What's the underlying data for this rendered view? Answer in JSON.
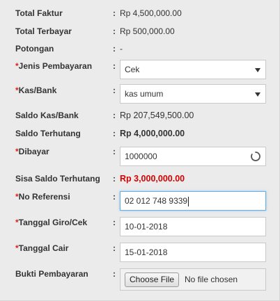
{
  "form": {
    "total_faktur": {
      "label": "Total Faktur",
      "value": "Rp 4,500,000.00"
    },
    "total_terbayar": {
      "label": "Total Terbayar",
      "value": "Rp 500,000.00"
    },
    "potongan": {
      "label": "Potongan",
      "value": "-"
    },
    "jenis_pembayaran": {
      "required": "*",
      "label": "Jenis Pembayaran",
      "value": "Cek"
    },
    "kas_bank": {
      "required": "*",
      "label": "Kas/Bank",
      "value": "kas umum"
    },
    "saldo_kas_bank": {
      "label": "Saldo Kas/Bank",
      "value": "Rp 207,549,500.00"
    },
    "saldo_terhutang": {
      "label": "Saldo Terhutang",
      "value": "Rp 4,000,000.00"
    },
    "dibayar": {
      "required": "*",
      "label": "Dibayar",
      "value": "1000000",
      "icon": "spinner-icon"
    },
    "sisa_saldo_terhutang": {
      "label": "Sisa Saldo Terhutang",
      "value": "Rp 3,000,000.00"
    },
    "no_referensi": {
      "required": "*",
      "label": "No Referensi",
      "value": "02 012 748 9339"
    },
    "tanggal_giro_cek": {
      "required": "*",
      "label": "Tanggal Giro/Cek",
      "value": "10-01-2018"
    },
    "tanggal_cair": {
      "required": "*",
      "label": "Tanggal Cair",
      "value": "15-01-2018"
    },
    "bukti_pembayaran": {
      "label": "Bukti Pembayaran",
      "button": "Choose File",
      "status": "No file chosen"
    }
  },
  "colon": ":",
  "colors": {
    "required": "#d9231c",
    "negative": "#d40000",
    "focus": "#66afe9"
  }
}
